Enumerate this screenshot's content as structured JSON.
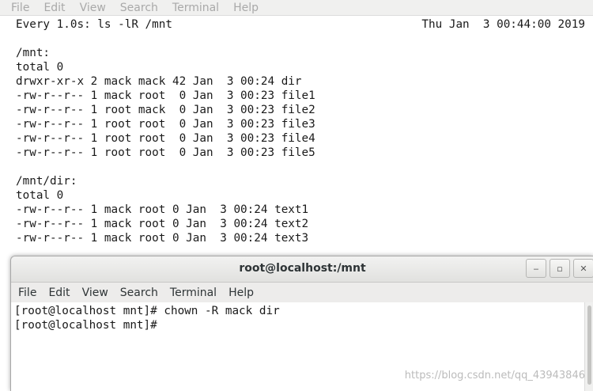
{
  "back_window": {
    "menu": [
      "File",
      "Edit",
      "View",
      "Search",
      "Terminal",
      "Help"
    ],
    "watch_command": "Every 1.0s: ls -lR /mnt",
    "watch_time": "Thu Jan  3 00:44:00 2019",
    "lines": [
      "",
      "/mnt:",
      "total 0",
      "drwxr-xr-x 2 mack mack 42 Jan  3 00:24 dir",
      "-rw-r--r-- 1 mack root  0 Jan  3 00:23 file1",
      "-rw-r--r-- 1 root mack  0 Jan  3 00:23 file2",
      "-rw-r--r-- 1 root root  0 Jan  3 00:23 file3",
      "-rw-r--r-- 1 root root  0 Jan  3 00:23 file4",
      "-rw-r--r-- 1 root root  0 Jan  3 00:23 file5",
      "",
      "/mnt/dir:",
      "total 0",
      "-rw-r--r-- 1 mack root 0 Jan  3 00:24 text1",
      "-rw-r--r-- 1 mack root 0 Jan  3 00:24 text2",
      "-rw-r--r-- 1 mack root 0 Jan  3 00:24 text3"
    ]
  },
  "front_window": {
    "title": "root@localhost:/mnt",
    "controls": {
      "minimize": "‒",
      "maximize": "▫",
      "close": "✕"
    },
    "menu": [
      "File",
      "Edit",
      "View",
      "Search",
      "Terminal",
      "Help"
    ],
    "lines": [
      "[root@localhost mnt]# chown -R mack dir",
      "[root@localhost mnt]# "
    ]
  },
  "watermark": "https://blog.csdn.net/qq_43943846"
}
